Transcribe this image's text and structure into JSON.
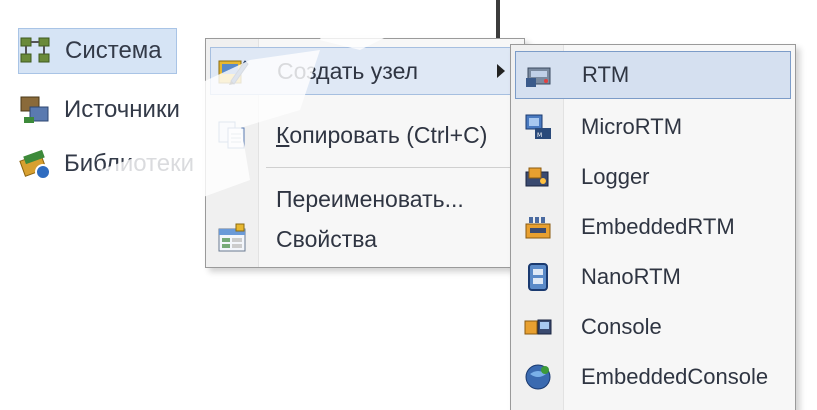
{
  "tree": {
    "items": [
      {
        "label": "Система",
        "icon": "network-icon",
        "selected": true
      },
      {
        "label": "Источники",
        "icon": "sources-icon",
        "selected": false
      },
      {
        "label": "Библиотеки",
        "icon": "library-icon",
        "selected": false
      }
    ]
  },
  "context_menu": {
    "items": [
      {
        "label": "Создать узел",
        "icon": "create-node-icon",
        "has_submenu": true,
        "highlighted": true
      },
      {
        "label_underlined": "К",
        "label_rest": "опировать (Ctrl+C)",
        "icon": "copy-icon"
      },
      {
        "label": "Переименовать..."
      },
      {
        "label": "Свойства",
        "icon": "properties-icon"
      }
    ]
  },
  "submenu": {
    "items": [
      {
        "label": "RTM",
        "icon": "rtm-icon",
        "highlighted": true
      },
      {
        "label": "MicroRTM",
        "icon": "micrortm-icon"
      },
      {
        "label": "Logger",
        "icon": "logger-icon"
      },
      {
        "label": "EmbeddedRTM",
        "icon": "embeddedrtm-icon"
      },
      {
        "label": "NanoRTM",
        "icon": "nanortm-icon"
      },
      {
        "label": "Console",
        "icon": "console-icon"
      },
      {
        "label": "EmbeddedConsole",
        "icon": "embeddedconsole-icon"
      }
    ]
  },
  "colors": {
    "highlight": "#dfe8f5",
    "highlight_border": "#a6bfe0",
    "tree_selected": "#d6e4f5",
    "watermark": "#cfd8e6"
  }
}
